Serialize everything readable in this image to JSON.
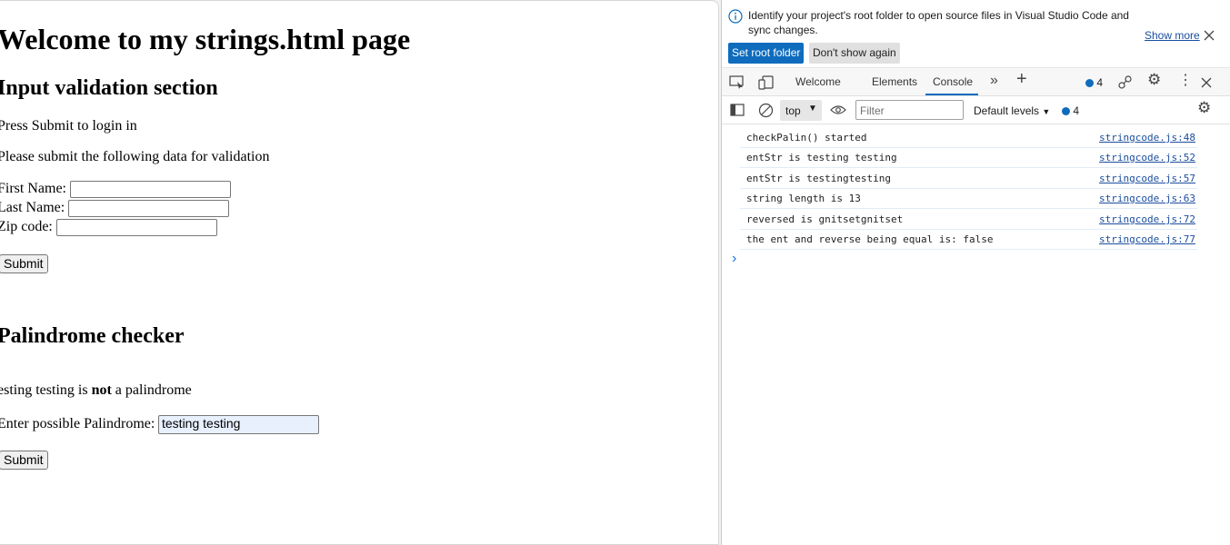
{
  "page": {
    "h1": "Welcome to my strings.html page",
    "section1_title": "Input validation section",
    "press_submit_text": "Press Submit to login in",
    "instructions_text": "Please submit the following data for validation",
    "first_name_label": "First Name:",
    "first_name_value": "",
    "last_name_label": "Last Name:",
    "last_name_value": "",
    "zip_label": "Zip code:",
    "zip_value": "",
    "submit_label": "Submit",
    "section2_title": "Palindrome checker",
    "result_prefix": "esting testing is ",
    "result_bold": "not",
    "result_suffix": " a palindrome",
    "palindrome_label": "Enter possible Palindrome:",
    "palindrome_value": "testing testing",
    "submit2_label": "Submit"
  },
  "devtools": {
    "banner": {
      "message": "Identify your project's root folder to open source files in Visual Studio Code and sync changes.",
      "show_more": "Show more",
      "set_root_folder": "Set root folder",
      "dont_show_again": "Don't show again"
    },
    "tabs": [
      {
        "label": "Welcome"
      },
      {
        "label": "Elements"
      },
      {
        "label": "Console"
      }
    ],
    "issues_count": "4",
    "toolbar": {
      "context": "top",
      "filter_placeholder": "Filter",
      "levels": "Default levels",
      "issues_count": "4"
    },
    "logs": [
      {
        "message": "checkPalin() started",
        "source": "stringcode.js:48"
      },
      {
        "message": "entStr is testing testing",
        "source": "stringcode.js:52"
      },
      {
        "message": "entStr is testingtesting",
        "source": "stringcode.js:57"
      },
      {
        "message": "string length is 13",
        "source": "stringcode.js:63"
      },
      {
        "message": "reversed is gnitsetgnitset",
        "source": "stringcode.js:72"
      },
      {
        "message": "the ent and reverse being equal is: false",
        "source": "stringcode.js:77"
      }
    ],
    "prompt": "›"
  }
}
